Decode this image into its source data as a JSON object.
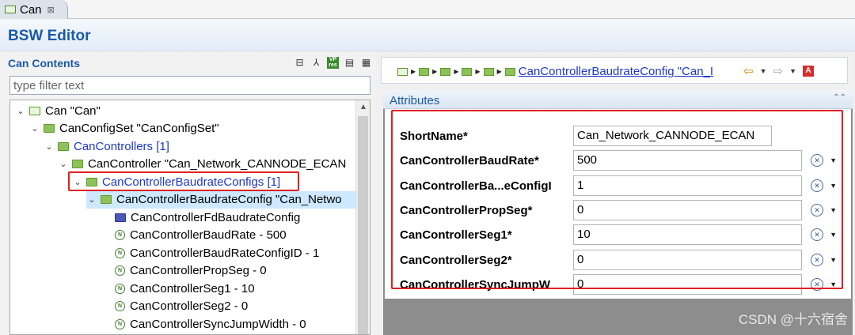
{
  "tab": {
    "label": "Can",
    "close": "⊠"
  },
  "editor": {
    "title": "BSW Editor"
  },
  "left": {
    "title": "Can Contents",
    "filter_placeholder": "type filter text",
    "tree": [
      {
        "label": "Can \"Can\"",
        "indent": 0,
        "icon": "ecu",
        "expanded": true
      },
      {
        "label": "CanConfigSet \"CanConfigSet\"",
        "indent": 1,
        "icon": "folder",
        "expanded": true
      },
      {
        "label": "CanControllers [1]",
        "indent": 2,
        "icon": "folder",
        "expanded": true,
        "blue": true
      },
      {
        "label": "CanController \"Can_Network_CANNODE_ECAN",
        "indent": 3,
        "icon": "folder",
        "expanded": true
      },
      {
        "label": "CanControllerBaudrateConfigs [1]",
        "indent": 4,
        "icon": "folder",
        "expanded": true,
        "blue": true,
        "highlight": true
      },
      {
        "label": "CanControllerBaudrateConfig \"Can_Netwo",
        "indent": 5,
        "icon": "folder",
        "expanded": true,
        "selected": true
      },
      {
        "label": "CanControllerFdBaudrateConfig",
        "indent": 6,
        "icon": "bluefolder"
      },
      {
        "label": "CanControllerBaudRate - 500",
        "indent": 6,
        "icon": "param"
      },
      {
        "label": "CanControllerBaudRateConfigID - 1",
        "indent": 6,
        "icon": "param"
      },
      {
        "label": "CanControllerPropSeg - 0",
        "indent": 6,
        "icon": "param"
      },
      {
        "label": "CanControllerSeg1 - 10",
        "indent": 6,
        "icon": "param"
      },
      {
        "label": "CanControllerSeg2 - 0",
        "indent": 6,
        "icon": "param"
      },
      {
        "label": "CanControllerSyncJumpWidth - 0",
        "indent": 6,
        "icon": "param"
      }
    ]
  },
  "breadcrumb": {
    "link": "CanControllerBaudrateConfig \"Can_I"
  },
  "attributes": {
    "title": "Attributes",
    "fields": [
      {
        "label": "ShortName*",
        "value": "Can_Network_CANNODE_ECAN",
        "has_controls": false
      },
      {
        "label": "CanControllerBaudRate*",
        "value": "500",
        "has_controls": true
      },
      {
        "label": "CanControllerBa...eConfigI",
        "value": "1",
        "has_controls": true
      },
      {
        "label": "CanControllerPropSeg*",
        "value": "0",
        "has_controls": true
      },
      {
        "label": "CanControllerSeg1*",
        "value": "10",
        "has_controls": true
      },
      {
        "label": "CanControllerSeg2*",
        "value": "0",
        "has_controls": true
      },
      {
        "label": "CanControllerSyncJumpW",
        "value": "0",
        "has_controls": true
      }
    ]
  },
  "watermark": "CSDN @十六宿舍",
  "colors": {
    "accent": "#1a5aa8",
    "link": "#1f37c8",
    "highlight_border": "#e02020",
    "selection": "#cde8ff"
  }
}
